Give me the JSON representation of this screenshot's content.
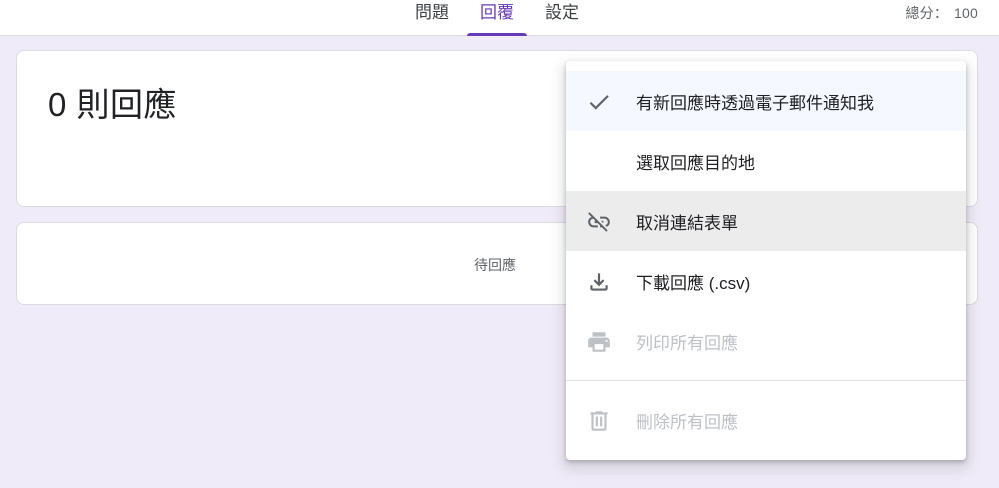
{
  "tabs": [
    {
      "label": "問題"
    },
    {
      "label": "回覆"
    },
    {
      "label": "設定"
    }
  ],
  "active_tab": "回覆",
  "score": {
    "label": "總分：",
    "value": "100"
  },
  "summary": {
    "count_text": "0 則回應"
  },
  "pending": {
    "text": "待回應"
  },
  "menu": {
    "items": [
      {
        "label": "有新回應時透過電子郵件通知我",
        "icon": "check-icon",
        "state": "checked"
      },
      {
        "label": "選取回應目的地",
        "icon": "",
        "state": "normal"
      },
      {
        "label": "取消連結表單",
        "icon": "link-off-icon",
        "state": "hover"
      },
      {
        "label": "下載回應 (.csv)",
        "icon": "download-icon",
        "state": "normal"
      },
      {
        "label": "列印所有回應",
        "icon": "print-icon",
        "state": "disabled"
      },
      {
        "label": "刪除所有回應",
        "icon": "trash-icon",
        "state": "disabled"
      }
    ]
  },
  "colors": {
    "accent": "#673ab7",
    "background": "#f0ebf8",
    "icon": "#5f6368",
    "disabled": "#bdc1c6",
    "hover_bg": "#ececec",
    "checked_bg": "#f5f8fe"
  }
}
